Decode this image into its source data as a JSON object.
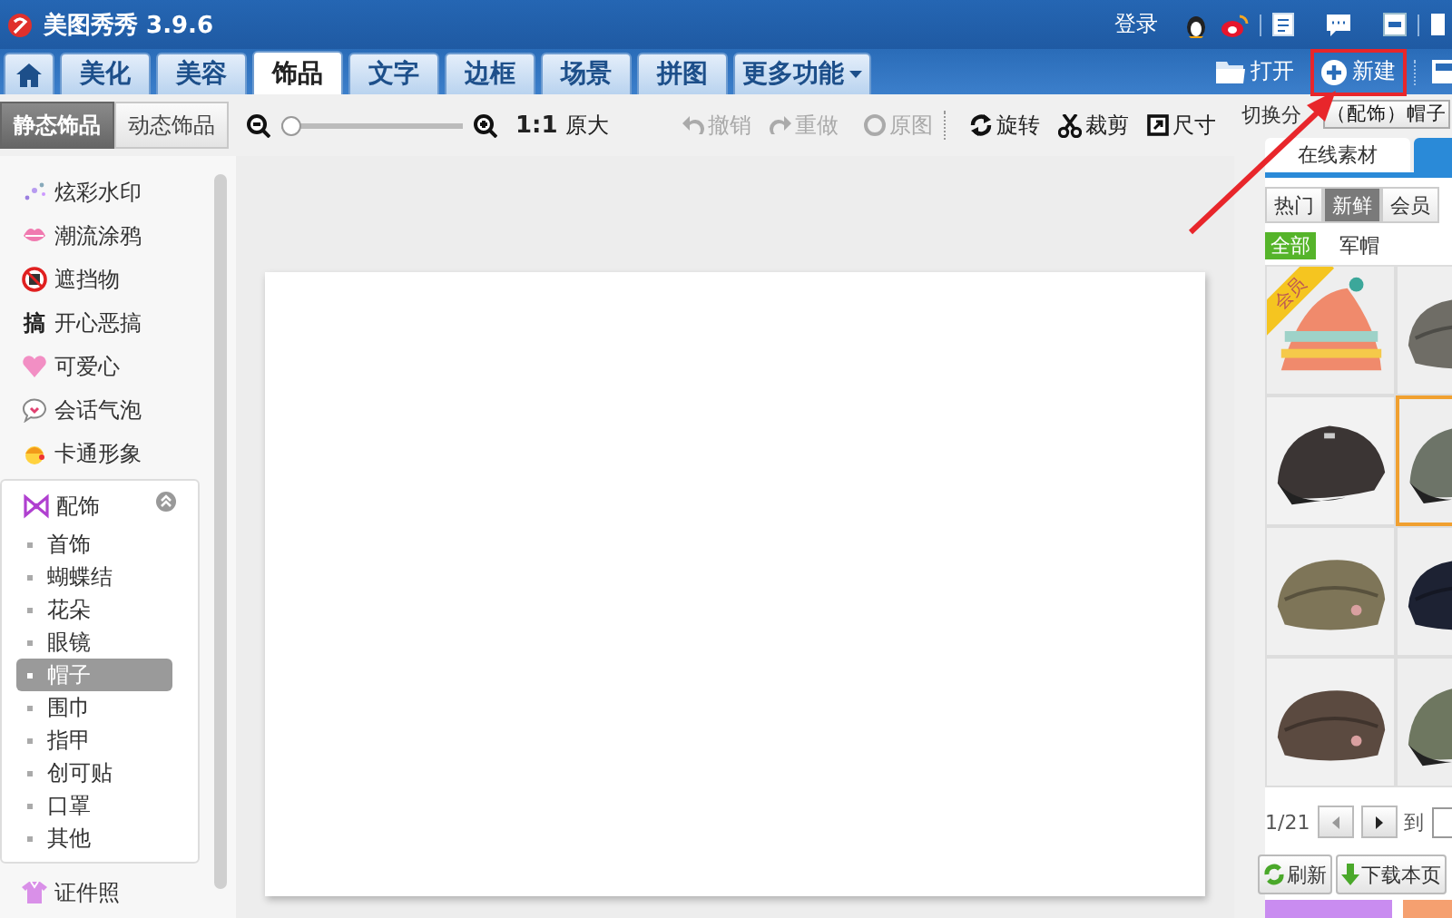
{
  "app": {
    "title": "美图秀秀 3.9.6",
    "login": "登录"
  },
  "tabs": [
    {
      "kind": "home",
      "selected": false
    },
    {
      "kind": "tab",
      "label": "美化",
      "selected": false
    },
    {
      "kind": "tab",
      "label": "美容",
      "selected": false
    },
    {
      "kind": "tab",
      "label": "饰品",
      "selected": true
    },
    {
      "kind": "tab",
      "label": "文字",
      "selected": false
    },
    {
      "kind": "tab",
      "label": "边框",
      "selected": false
    },
    {
      "kind": "tab",
      "label": "场景",
      "selected": false
    },
    {
      "kind": "tab",
      "label": "拼图",
      "selected": false
    },
    {
      "kind": "menu",
      "label": "更多功能",
      "selected": false
    }
  ],
  "file_buttons": [
    {
      "label": "打开",
      "highlighted": false
    },
    {
      "label": "新建",
      "highlighted": true
    }
  ],
  "toolbar": {
    "zoom": {
      "level": 0,
      "ratio": "1:1",
      "label": "原大"
    },
    "actions": [
      {
        "kind": "undo",
        "label": "撤销",
        "disabled": true
      },
      {
        "kind": "redo",
        "label": "重做",
        "disabled": true
      },
      {
        "kind": "original",
        "label": "原图",
        "disabled": true
      },
      {
        "kind": "rotate",
        "label": "旋转",
        "disabled": false
      },
      {
        "kind": "crop",
        "label": "裁剪",
        "disabled": false
      },
      {
        "kind": "size",
        "label": "尺寸",
        "disabled": false
      }
    ]
  },
  "sidebar": {
    "modes": [
      {
        "label": "静态饰品",
        "selected": true
      },
      {
        "label": "动态饰品",
        "selected": false
      }
    ],
    "items": [
      {
        "kind": "sparkle",
        "label": "炫彩水印"
      },
      {
        "kind": "lips",
        "label": "潮流涂鸦"
      },
      {
        "kind": "block",
        "label": "遮挡物"
      },
      {
        "kind": "glyph",
        "icon_text": "搞",
        "label": "开心恶搞"
      },
      {
        "kind": "heart",
        "label": "可爱心"
      },
      {
        "kind": "bubble",
        "label": "会话气泡"
      },
      {
        "kind": "cartoon",
        "label": "卡通形象"
      },
      {
        "kind": "bow",
        "label": "配饰",
        "expanded": true,
        "children": [
          {
            "label": "首饰",
            "selected": false
          },
          {
            "label": "蝴蝶结",
            "selected": false
          },
          {
            "label": "花朵",
            "selected": false
          },
          {
            "label": "眼镜",
            "selected": false
          },
          {
            "label": "帽子",
            "selected": true
          },
          {
            "label": "围巾",
            "selected": false
          },
          {
            "label": "指甲",
            "selected": false
          },
          {
            "label": "创可贴",
            "selected": false
          },
          {
            "label": "口罩",
            "selected": false
          },
          {
            "label": "其他",
            "selected": false
          }
        ]
      },
      {
        "kind": "shirt",
        "label": "证件照"
      }
    ]
  },
  "panel": {
    "category_label": "切换分",
    "category_value": "（配饰）帽子",
    "source_tabs": [
      {
        "label": "在线素材",
        "selected": true
      }
    ],
    "sort_tabs": [
      {
        "label": "热门",
        "selected": false
      },
      {
        "label": "新鲜",
        "selected": true
      },
      {
        "label": "会员",
        "selected": false
      }
    ],
    "filters": [
      {
        "label": "全部",
        "selected": true
      },
      {
        "label": "军帽",
        "selected": false
      }
    ],
    "items": [
      {
        "kind": "picture",
        "badge": "会员",
        "selected": false
      },
      {
        "kind": "picture",
        "selected": false
      },
      {
        "kind": "picture",
        "selected": false
      },
      {
        "kind": "picture",
        "selected": true
      },
      {
        "kind": "picture",
        "selected": false
      },
      {
        "kind": "picture",
        "selected": false
      },
      {
        "kind": "picture",
        "selected": false
      },
      {
        "kind": "picture",
        "selected": false
      }
    ],
    "pager": {
      "page": "1/21",
      "goto": "到"
    },
    "buttons": [
      {
        "kind": "refresh",
        "label": "刷新"
      },
      {
        "kind": "download",
        "label": "下载本页"
      }
    ]
  }
}
